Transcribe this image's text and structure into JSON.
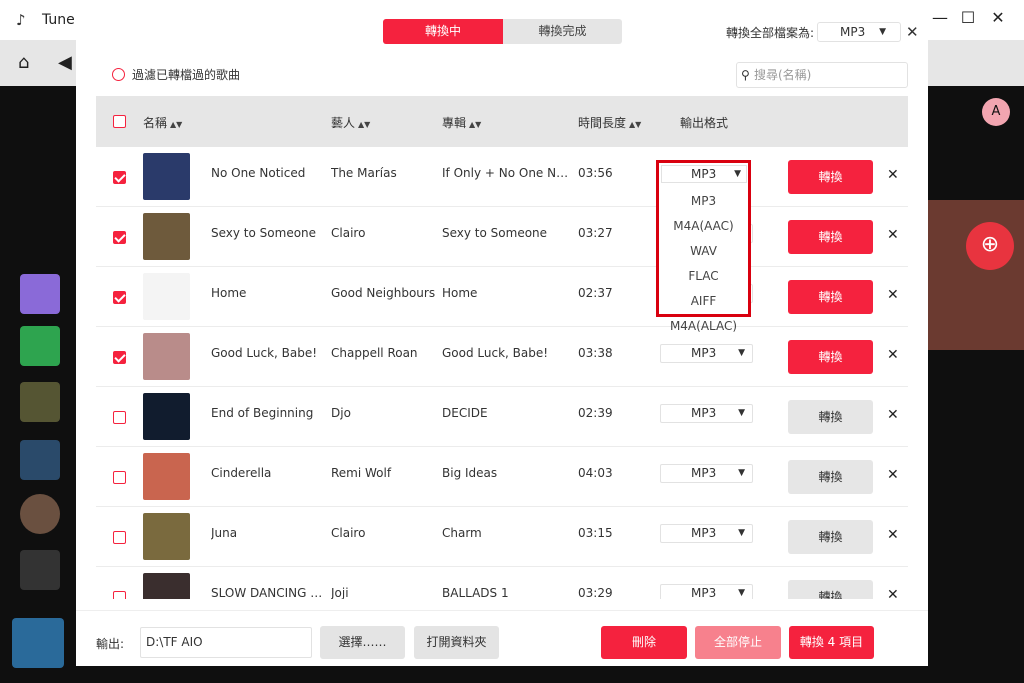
{
  "app": {
    "title": "Tunel"
  },
  "window_controls": [
    "—",
    "☐",
    "✕"
  ],
  "background": {
    "avatar_letter": "A"
  },
  "dialog": {
    "tabs": [
      {
        "label": "轉換中",
        "active": true
      },
      {
        "label": "轉換完成",
        "active": false
      }
    ],
    "convert_all_label": "轉換全部檔案為:",
    "convert_all_value": "MP3",
    "close_glyph": "✕",
    "filter_label": "過濾已轉檔過的歌曲",
    "search_placeholder": "搜尋(名稱)",
    "columns": {
      "name": "名稱",
      "artist": "藝人",
      "album": "專輯",
      "duration": "時間長度",
      "format": "輸出格式"
    },
    "convert_label": "轉換",
    "remove_glyph": "✕",
    "rows": [
      {
        "checked": true,
        "name": "No One Noticed",
        "artist": "The Marías",
        "album": "If Only + No One Notic…",
        "duration": "03:56",
        "format": "MP3",
        "convert_active": true,
        "thumb": "#2a3a6a"
      },
      {
        "checked": true,
        "name": "Sexy to Someone",
        "artist": "Clairo",
        "album": "Sexy to Someone",
        "duration": "03:27",
        "format": "MP3",
        "convert_active": true,
        "thumb": "#6e5a3c"
      },
      {
        "checked": true,
        "name": "Home",
        "artist": "Good Neighbours",
        "album": "Home",
        "duration": "02:37",
        "format": "MP3",
        "convert_active": true,
        "thumb": "#f4f4f4"
      },
      {
        "checked": true,
        "name": "Good Luck, Babe!",
        "artist": "Chappell Roan",
        "album": "Good Luck, Babe!",
        "duration": "03:38",
        "format": "MP3",
        "convert_active": true,
        "thumb": "#b98c8a"
      },
      {
        "checked": false,
        "name": "End of Beginning",
        "artist": "Djo",
        "album": "DECIDE",
        "duration": "02:39",
        "format": "MP3",
        "convert_active": false,
        "thumb": "#111c2e"
      },
      {
        "checked": false,
        "name": "Cinderella",
        "artist": "Remi Wolf",
        "album": "Big Ideas",
        "duration": "04:03",
        "format": "MP3",
        "convert_active": false,
        "thumb": "#c9654f"
      },
      {
        "checked": false,
        "name": "Juna",
        "artist": "Clairo",
        "album": "Charm",
        "duration": "03:15",
        "format": "MP3",
        "convert_active": false,
        "thumb": "#7a6a3e"
      },
      {
        "checked": false,
        "name": "SLOW DANCING I…",
        "artist": "Joji",
        "album": "BALLADS 1",
        "duration": "03:29",
        "format": "MP3",
        "convert_active": false,
        "thumb": "#3a2e2e"
      }
    ],
    "format_dropdown": {
      "selected": "MP3",
      "options": [
        "MP3",
        "M4A(AAC)",
        "WAV",
        "FLAC",
        "AIFF",
        "M4A(ALAC)"
      ]
    },
    "footer": {
      "output_label": "輸出:",
      "output_path": "D:\\TF AIO",
      "choose_label": "選擇……",
      "open_folder_label": "打開資料夾",
      "delete_label": "刪除",
      "stop_all_label": "全部停止",
      "convert_items_label": "轉換 4 項目"
    }
  },
  "colors": {
    "accent": "#f5223e",
    "highlight_border": "#d9000f"
  }
}
